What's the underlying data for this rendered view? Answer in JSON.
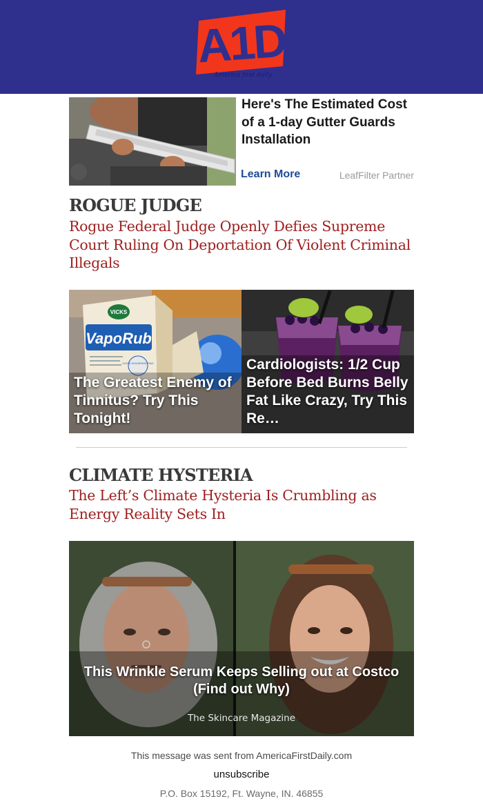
{
  "brand": {
    "logo_text": "A1D",
    "tagline": "America first daily",
    "header_color": "#2f2f8d",
    "logo_color": "#f2361c"
  },
  "ad_top": {
    "title": "Here's The Estimated Cost of a 1-day Gutter Guards Installation",
    "cta": "Learn More",
    "sponsor": "LeafFilter Partner"
  },
  "articles": [
    {
      "tag": "ROGUE JUDGE",
      "headline": "Rogue Federal Judge Openly Defies Supreme Court Ruling On Deportation Of Violent Criminal Illegals"
    },
    {
      "tag": "CLIMATE HYSTERIA",
      "headline": "The Left’s Climate Hysteria Is Crumbling as Energy Reality Sets In"
    }
  ],
  "sponsored_tiles": [
    {
      "caption": "The Greatest Enemy of Tinnitus? Try This Tonight!",
      "box_brand": "VICKS",
      "box_product": "VapoRub",
      "box_seal": "GOOD HOUSEKEEPING"
    },
    {
      "caption": "Cardiologists: 1/2 Cup Before Bed Burns Belly Fat Like Crazy, Try This Re…"
    }
  ],
  "ad_big": {
    "caption": "This Wrinkle Serum Keeps Selling out at Costco (Find out Why)",
    "source": "The Skincare Magazine"
  },
  "footer": {
    "sent_from": "This message was sent from AmericaFirstDaily.com",
    "unsubscribe": "unsubscribe",
    "address": "P.O. Box 15192, Ft. Wayne, IN. 46855"
  },
  "colors": {
    "headline": "#9e2020",
    "tag": "#3a3a3a",
    "cta": "#1e4a9a"
  }
}
